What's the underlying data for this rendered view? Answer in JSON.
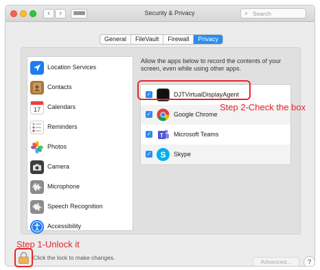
{
  "window": {
    "title": "Security & Privacy",
    "search_placeholder": "Search",
    "nav_back": "‹",
    "nav_forward": "›",
    "grid_glyph": "▦▦▦"
  },
  "tabs": [
    {
      "label": "General",
      "active": false
    },
    {
      "label": "FileVault",
      "active": false
    },
    {
      "label": "Firewall",
      "active": false
    },
    {
      "label": "Privacy",
      "active": true
    }
  ],
  "sidebar": {
    "items": [
      {
        "label": "Location Services",
        "icon": "location-arrow-icon",
        "selected": false
      },
      {
        "label": "Contacts",
        "icon": "contacts-book-icon",
        "selected": false
      },
      {
        "label": "Calendars",
        "icon": "calendar-icon",
        "selected": false
      },
      {
        "label": "Reminders",
        "icon": "reminders-icon",
        "selected": false
      },
      {
        "label": "Photos",
        "icon": "photos-flower-icon",
        "selected": false
      },
      {
        "label": "Camera",
        "icon": "camera-icon",
        "selected": false
      },
      {
        "label": "Microphone",
        "icon": "microphone-waveform-icon",
        "selected": false
      },
      {
        "label": "Speech Recognition",
        "icon": "speech-waveform-icon",
        "selected": false
      },
      {
        "label": "Accessibility",
        "icon": "accessibility-icon",
        "selected": false
      }
    ]
  },
  "main": {
    "description": "Allow the apps below to record the contents of your screen, even while using other apps.",
    "apps": [
      {
        "name": "DJTVirtualDisplayAgent",
        "checked": true,
        "icon": "terminal-app-icon"
      },
      {
        "name": "Google Chrome",
        "checked": true,
        "icon": "chrome-icon"
      },
      {
        "name": "Microsoft Teams",
        "checked": true,
        "icon": "teams-icon"
      },
      {
        "name": "Skype",
        "checked": true,
        "icon": "skype-icon"
      }
    ]
  },
  "annotations": {
    "step1": "Step 1-Unlock it",
    "step2": "Step 2-Check the box",
    "color": "#e3262d"
  },
  "footer": {
    "lock_hint": "Click the lock to make changes.",
    "advanced_label": "Advanced...",
    "help_label": "?"
  },
  "colors": {
    "accent": "#2a8cf3",
    "annotation_red": "#e3262d"
  }
}
